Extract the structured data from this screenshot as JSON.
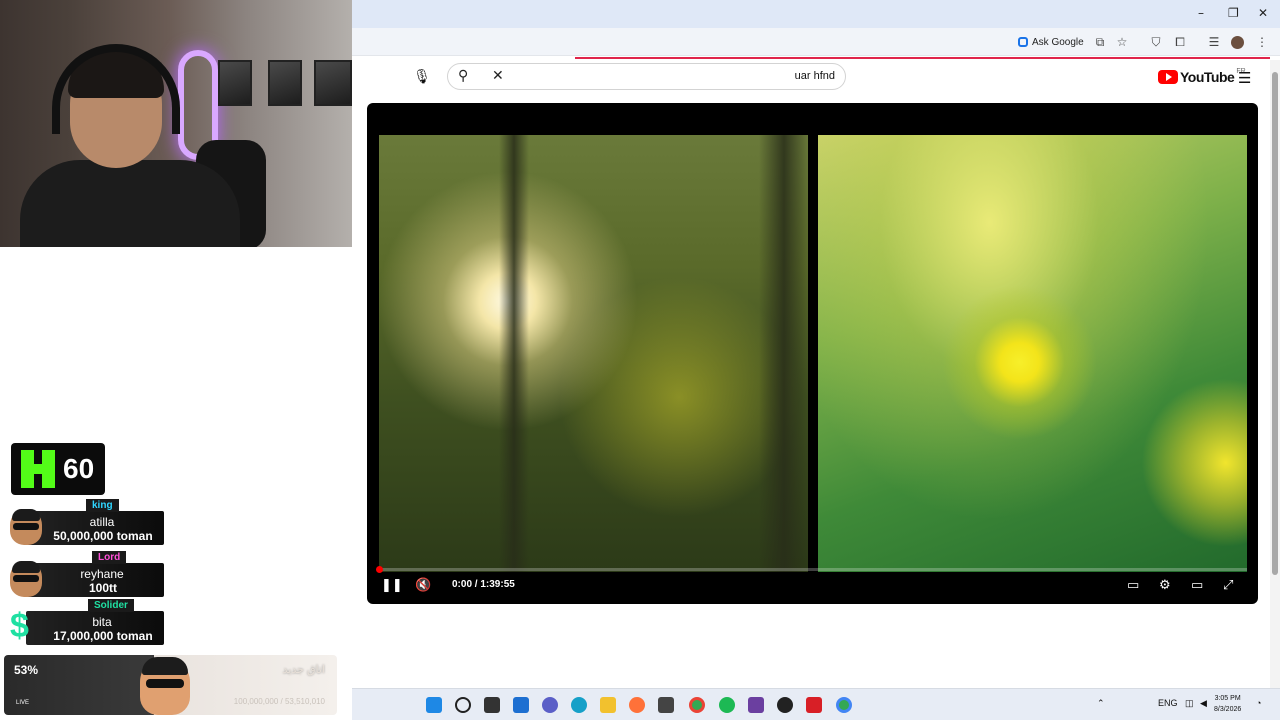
{
  "browser": {
    "window_controls": {
      "minimize": "–",
      "restore": "❐",
      "close": "✕"
    },
    "ask_google_label": "Ask Google",
    "accent_loading_color": "#e0254b"
  },
  "youtube": {
    "search": {
      "query": "uar hfnd"
    },
    "logo": {
      "word": "YouTube",
      "region": "FR"
    },
    "icons": [
      "mic-icon",
      "search-icon",
      "clear-icon",
      "menu-icon"
    ]
  },
  "player": {
    "current_time": "0:00",
    "duration": "1:39:55",
    "time_text": "0:00 / 1:39:55",
    "progress": 0,
    "controls": [
      "pause-icon",
      "mute-icon",
      "subtitles-icon",
      "settings-icon",
      "theater-icon",
      "fullscreen-icon"
    ]
  },
  "overlay": {
    "viewers": {
      "count": "60"
    },
    "donations": [
      {
        "rank": "king",
        "name": "atilla",
        "amount": "50,000,000 toman",
        "rank_color": "#2fd6ff"
      },
      {
        "rank": "Lord",
        "name": "reyhane",
        "amount": "100tt",
        "rank_color": "#ff4fd8"
      },
      {
        "rank": "Solider",
        "name": "bita",
        "amount": "17,000,000 toman",
        "rank_color": "#1fe0a2"
      }
    ],
    "goal": {
      "percent": "53%",
      "title": "اتاق جدید",
      "amount": "100,000,000 / 53,510,010",
      "live": "LIVE"
    }
  },
  "taskbar": {
    "tray": {
      "language": "ENG"
    },
    "clock": {
      "time": "3:05 PM",
      "date": "8/3/2026"
    },
    "apps": [
      "start-icon",
      "search-icon",
      "task-view-icon",
      "widgets-icon",
      "chat-icon",
      "edge-icon",
      "file-explorer-icon",
      "firefox-icon",
      "store-icon",
      "chrome-icon",
      "spotify-icon",
      "r-app-icon",
      "obs-icon",
      "v-app-icon",
      "chrome-alt-icon"
    ]
  }
}
